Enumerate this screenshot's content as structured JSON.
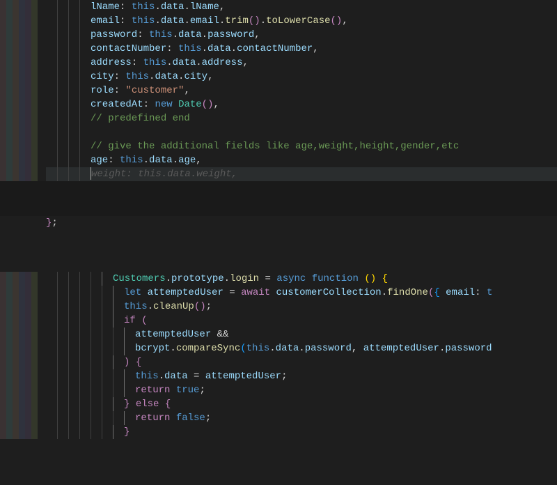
{
  "code": {
    "lines": [
      {
        "indent": 4,
        "tokens": [
          {
            "t": "lName",
            "c": "prop"
          },
          {
            "t": ": ",
            "c": "punct"
          },
          {
            "t": "this",
            "c": "this"
          },
          {
            "t": ".",
            "c": "punct"
          },
          {
            "t": "data",
            "c": "var"
          },
          {
            "t": ".",
            "c": "punct"
          },
          {
            "t": "lName",
            "c": "var"
          },
          {
            "t": ",",
            "c": "punct"
          }
        ]
      },
      {
        "indent": 4,
        "tokens": [
          {
            "t": "email",
            "c": "prop"
          },
          {
            "t": ": ",
            "c": "punct"
          },
          {
            "t": "this",
            "c": "this"
          },
          {
            "t": ".",
            "c": "punct"
          },
          {
            "t": "data",
            "c": "var"
          },
          {
            "t": ".",
            "c": "punct"
          },
          {
            "t": "email",
            "c": "var"
          },
          {
            "t": ".",
            "c": "punct"
          },
          {
            "t": "trim",
            "c": "method"
          },
          {
            "t": "()",
            "c": "paren2"
          },
          {
            "t": ".",
            "c": "punct"
          },
          {
            "t": "toLowerCase",
            "c": "method"
          },
          {
            "t": "()",
            "c": "paren2"
          },
          {
            "t": ",",
            "c": "punct"
          }
        ]
      },
      {
        "indent": 4,
        "tokens": [
          {
            "t": "password",
            "c": "prop"
          },
          {
            "t": ": ",
            "c": "punct"
          },
          {
            "t": "this",
            "c": "this"
          },
          {
            "t": ".",
            "c": "punct"
          },
          {
            "t": "data",
            "c": "var"
          },
          {
            "t": ".",
            "c": "punct"
          },
          {
            "t": "password",
            "c": "var"
          },
          {
            "t": ",",
            "c": "punct"
          }
        ]
      },
      {
        "indent": 4,
        "tokens": [
          {
            "t": "contactNumber",
            "c": "prop"
          },
          {
            "t": ": ",
            "c": "punct"
          },
          {
            "t": "this",
            "c": "this"
          },
          {
            "t": ".",
            "c": "punct"
          },
          {
            "t": "data",
            "c": "var"
          },
          {
            "t": ".",
            "c": "punct"
          },
          {
            "t": "contactNumber",
            "c": "var"
          },
          {
            "t": ",",
            "c": "punct"
          }
        ]
      },
      {
        "indent": 4,
        "tokens": [
          {
            "t": "address",
            "c": "prop"
          },
          {
            "t": ": ",
            "c": "punct"
          },
          {
            "t": "this",
            "c": "this"
          },
          {
            "t": ".",
            "c": "punct"
          },
          {
            "t": "data",
            "c": "var"
          },
          {
            "t": ".",
            "c": "punct"
          },
          {
            "t": "address",
            "c": "var"
          },
          {
            "t": ",",
            "c": "punct"
          }
        ]
      },
      {
        "indent": 4,
        "tokens": [
          {
            "t": "city",
            "c": "prop"
          },
          {
            "t": ": ",
            "c": "punct"
          },
          {
            "t": "this",
            "c": "this"
          },
          {
            "t": ".",
            "c": "punct"
          },
          {
            "t": "data",
            "c": "var"
          },
          {
            "t": ".",
            "c": "punct"
          },
          {
            "t": "city",
            "c": "var"
          },
          {
            "t": ",",
            "c": "punct"
          }
        ]
      },
      {
        "indent": 4,
        "tokens": [
          {
            "t": "role",
            "c": "prop"
          },
          {
            "t": ": ",
            "c": "punct"
          },
          {
            "t": "\"customer\"",
            "c": "str"
          },
          {
            "t": ",",
            "c": "punct"
          }
        ]
      },
      {
        "indent": 4,
        "tokens": [
          {
            "t": "createdAt",
            "c": "prop"
          },
          {
            "t": ": ",
            "c": "punct"
          },
          {
            "t": "new",
            "c": "new"
          },
          {
            "t": " ",
            "c": "punct"
          },
          {
            "t": "Date",
            "c": "class"
          },
          {
            "t": "()",
            "c": "paren2"
          },
          {
            "t": ",",
            "c": "punct"
          }
        ]
      },
      {
        "indent": 4,
        "tokens": [
          {
            "t": "// predefined end",
            "c": "comment"
          }
        ]
      },
      {
        "indent": 4,
        "tokens": []
      },
      {
        "indent": 4,
        "tokens": [
          {
            "t": "// give the additional fields like age,weight,height,gender,etc",
            "c": "comment"
          }
        ]
      },
      {
        "indent": 4,
        "tokens": [
          {
            "t": "age",
            "c": "prop"
          },
          {
            "t": ": ",
            "c": "punct"
          },
          {
            "t": "this",
            "c": "this"
          },
          {
            "t": ".",
            "c": "punct"
          },
          {
            "t": "data",
            "c": "var"
          },
          {
            "t": ".",
            "c": "punct"
          },
          {
            "t": "age",
            "c": "var"
          },
          {
            "t": ",",
            "c": "punct"
          }
        ]
      },
      {
        "indent": 4,
        "cursor": true,
        "tokens": [
          {
            "t": "weight: this.data.weight,",
            "c": "suggest"
          }
        ]
      },
      {
        "indent": 0,
        "spacer": true
      },
      {
        "indent": 0,
        "tokens": [
          {
            "t": "}",
            "c": "brace-p"
          },
          {
            "t": ";",
            "c": "punct"
          }
        ],
        "close": true
      },
      {
        "indent": 0,
        "spacer2": true
      },
      {
        "indent": 6,
        "tokens": [
          {
            "t": "Customers",
            "c": "class"
          },
          {
            "t": ".",
            "c": "punct"
          },
          {
            "t": "prototype",
            "c": "var"
          },
          {
            "t": ".",
            "c": "punct"
          },
          {
            "t": "login",
            "c": "method"
          },
          {
            "t": " = ",
            "c": "op"
          },
          {
            "t": "async",
            "c": "kw"
          },
          {
            "t": " ",
            "c": "punct"
          },
          {
            "t": "function",
            "c": "kw"
          },
          {
            "t": " ",
            "c": "punct"
          },
          {
            "t": "()",
            "c": "paren"
          },
          {
            "t": " ",
            "c": "punct"
          },
          {
            "t": "{",
            "c": "brace-y"
          }
        ]
      },
      {
        "indent": 7,
        "tokens": [
          {
            "t": "let",
            "c": "let"
          },
          {
            "t": " ",
            "c": "punct"
          },
          {
            "t": "attemptedUser",
            "c": "var"
          },
          {
            "t": " = ",
            "c": "op"
          },
          {
            "t": "await",
            "c": "await"
          },
          {
            "t": " ",
            "c": "punct"
          },
          {
            "t": "customerCollection",
            "c": "var"
          },
          {
            "t": ".",
            "c": "punct"
          },
          {
            "t": "findOne",
            "c": "method"
          },
          {
            "t": "(",
            "c": "paren2"
          },
          {
            "t": "{",
            "c": "brace-b"
          },
          {
            "t": " ",
            "c": "punct"
          },
          {
            "t": "email",
            "c": "prop"
          },
          {
            "t": ": ",
            "c": "punct"
          },
          {
            "t": "t",
            "c": "this"
          }
        ]
      },
      {
        "indent": 7,
        "tokens": [
          {
            "t": "this",
            "c": "this"
          },
          {
            "t": ".",
            "c": "punct"
          },
          {
            "t": "cleanUp",
            "c": "method"
          },
          {
            "t": "()",
            "c": "paren2"
          },
          {
            "t": ";",
            "c": "punct"
          }
        ]
      },
      {
        "indent": 7,
        "tokens": [
          {
            "t": "if",
            "c": "await"
          },
          {
            "t": " ",
            "c": "punct"
          },
          {
            "t": "(",
            "c": "paren2"
          }
        ]
      },
      {
        "indent": 8,
        "tokens": [
          {
            "t": "attemptedUser",
            "c": "var"
          },
          {
            "t": " && ",
            "c": "op"
          }
        ]
      },
      {
        "indent": 8,
        "tokens": [
          {
            "t": "bcrypt",
            "c": "var"
          },
          {
            "t": ".",
            "c": "punct"
          },
          {
            "t": "compareSync",
            "c": "method"
          },
          {
            "t": "(",
            "c": "brace-b"
          },
          {
            "t": "this",
            "c": "this"
          },
          {
            "t": ".",
            "c": "punct"
          },
          {
            "t": "data",
            "c": "var"
          },
          {
            "t": ".",
            "c": "punct"
          },
          {
            "t": "password",
            "c": "var"
          },
          {
            "t": ", ",
            "c": "punct"
          },
          {
            "t": "attemptedUser",
            "c": "var"
          },
          {
            "t": ".",
            "c": "punct"
          },
          {
            "t": "password",
            "c": "var"
          }
        ]
      },
      {
        "indent": 7,
        "tokens": [
          {
            "t": ")",
            "c": "paren2"
          },
          {
            "t": " ",
            "c": "punct"
          },
          {
            "t": "{",
            "c": "brace-p"
          }
        ]
      },
      {
        "indent": 8,
        "tokens": [
          {
            "t": "this",
            "c": "this"
          },
          {
            "t": ".",
            "c": "punct"
          },
          {
            "t": "data",
            "c": "var"
          },
          {
            "t": " = ",
            "c": "op"
          },
          {
            "t": "attemptedUser",
            "c": "var"
          },
          {
            "t": ";",
            "c": "punct"
          }
        ]
      },
      {
        "indent": 8,
        "tokens": [
          {
            "t": "return",
            "c": "return"
          },
          {
            "t": " ",
            "c": "punct"
          },
          {
            "t": "true",
            "c": "kw"
          },
          {
            "t": ";",
            "c": "punct"
          }
        ]
      },
      {
        "indent": 7,
        "tokens": [
          {
            "t": "}",
            "c": "brace-p"
          },
          {
            "t": " ",
            "c": "punct"
          },
          {
            "t": "else",
            "c": "await"
          },
          {
            "t": " ",
            "c": "punct"
          },
          {
            "t": "{",
            "c": "brace-p"
          }
        ]
      },
      {
        "indent": 8,
        "tokens": [
          {
            "t": "return",
            "c": "return"
          },
          {
            "t": " ",
            "c": "punct"
          },
          {
            "t": "false",
            "c": "kw"
          },
          {
            "t": ";",
            "c": "punct"
          }
        ]
      },
      {
        "indent": 7,
        "tokens": [
          {
            "t": "}",
            "c": "brace-p"
          }
        ]
      }
    ]
  }
}
